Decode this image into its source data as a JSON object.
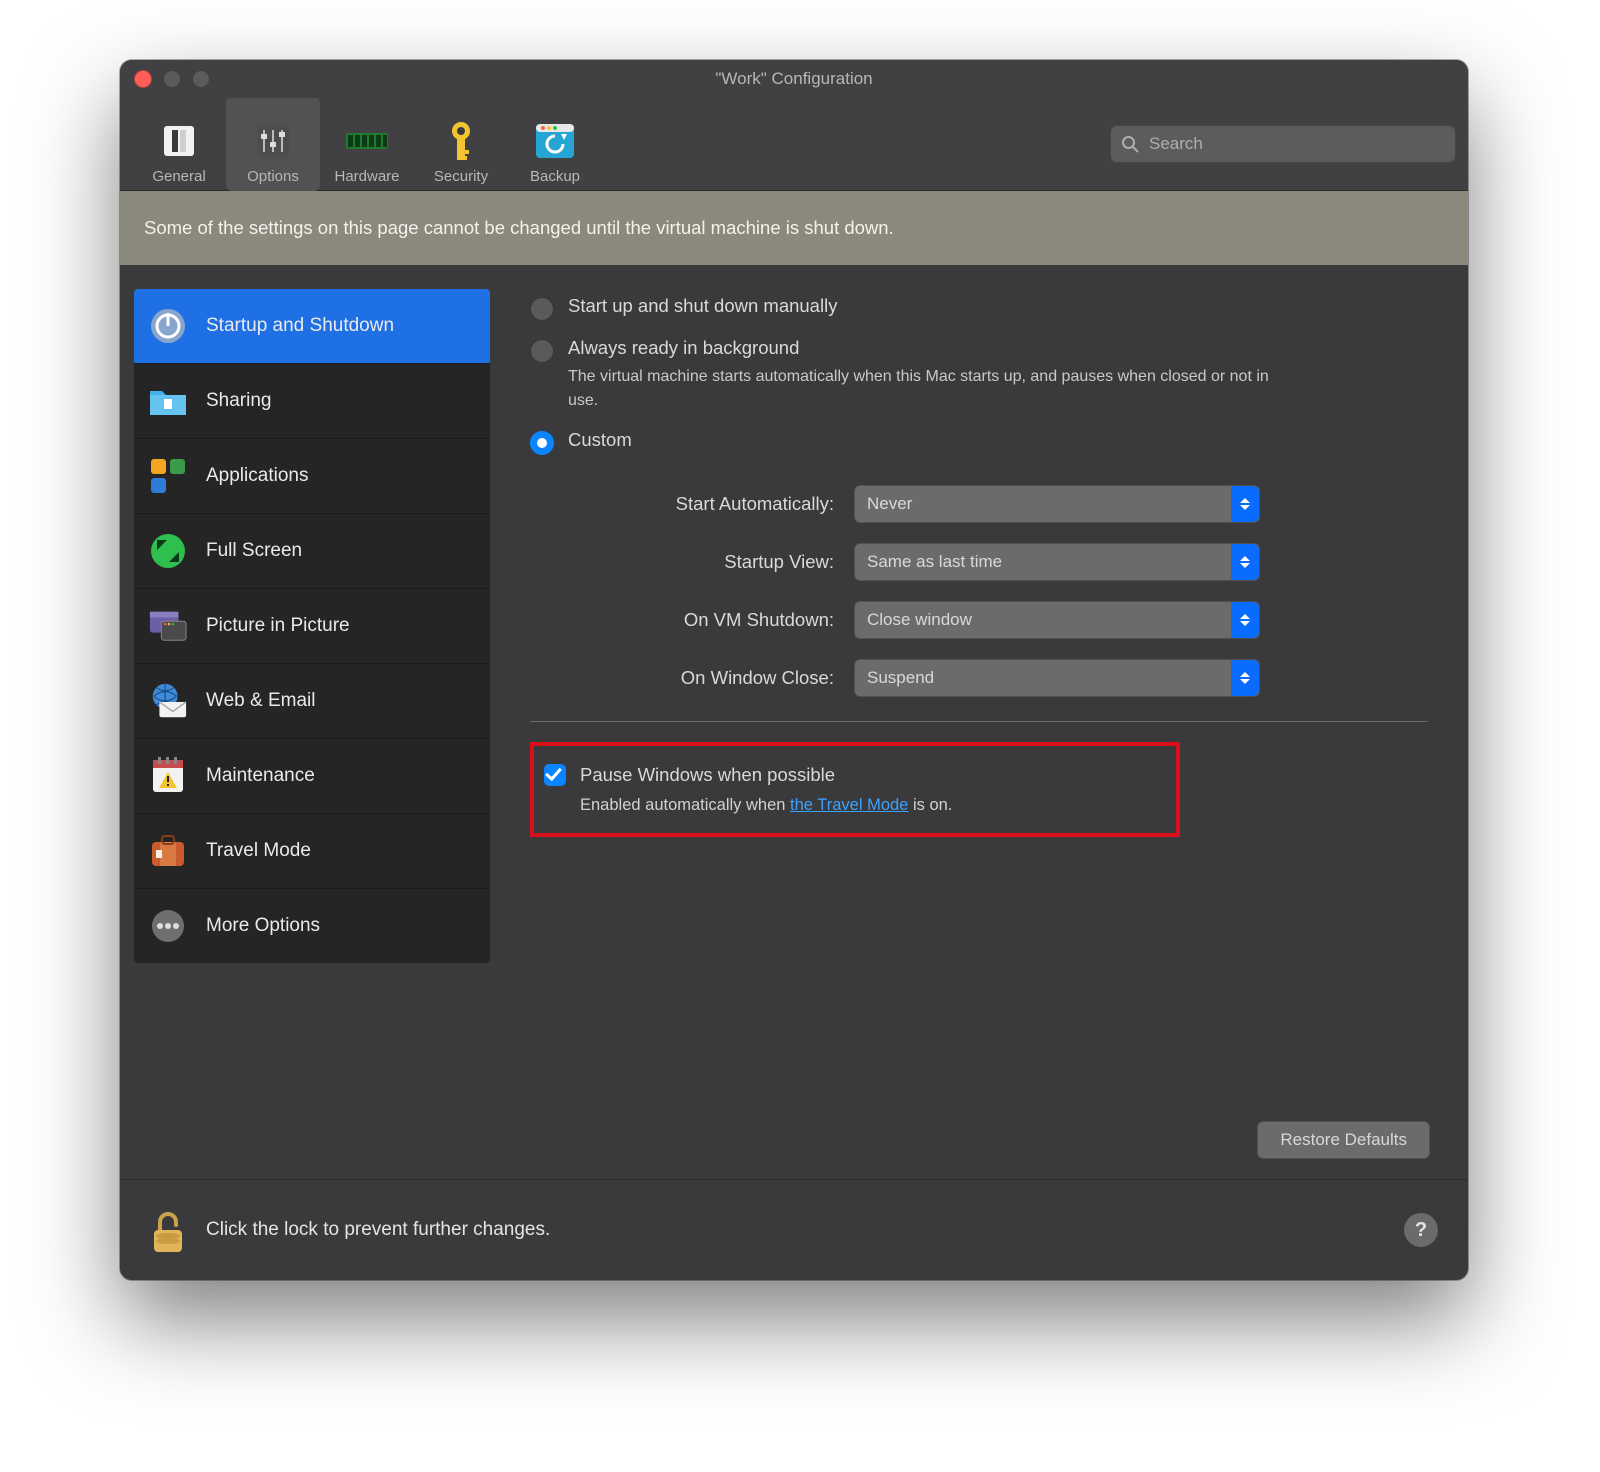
{
  "window": {
    "title": "\"Work\" Configuration"
  },
  "toolbar": {
    "items": [
      {
        "label": "General"
      },
      {
        "label": "Options"
      },
      {
        "label": "Hardware"
      },
      {
        "label": "Security"
      },
      {
        "label": "Backup"
      }
    ],
    "active_index": 1,
    "search_placeholder": "Search"
  },
  "banner": {
    "text": "Some of the settings on this page cannot be changed until the virtual machine is shut down."
  },
  "sidebar": {
    "items": [
      {
        "label": "Startup and Shutdown"
      },
      {
        "label": "Sharing"
      },
      {
        "label": "Applications"
      },
      {
        "label": "Full Screen"
      },
      {
        "label": "Picture in Picture"
      },
      {
        "label": "Web & Email"
      },
      {
        "label": "Maintenance"
      },
      {
        "label": "Travel Mode"
      },
      {
        "label": "More Options"
      }
    ],
    "selected_index": 0
  },
  "content": {
    "radios": {
      "manual": "Start up and shut down manually",
      "always_ready": "Always ready in background",
      "always_ready_desc": "The virtual machine starts automatically when this Mac starts up, and pauses when closed or not in use.",
      "custom": "Custom",
      "selected": "custom"
    },
    "fields": {
      "start_auto": {
        "label": "Start Automatically:",
        "value": "Never"
      },
      "startup_view": {
        "label": "Startup View:",
        "value": "Same as last time"
      },
      "on_shutdown": {
        "label": "On VM Shutdown:",
        "value": "Close window"
      },
      "on_close": {
        "label": "On Window Close:",
        "value": "Suspend"
      }
    },
    "pause": {
      "label": "Pause Windows when possible",
      "checked": true,
      "desc_prefix": "Enabled automatically when ",
      "desc_link": "the Travel Mode",
      "desc_suffix": " is on."
    },
    "restore_defaults": "Restore Defaults"
  },
  "footer": {
    "text": "Click the lock to prevent further changes.",
    "help": "?"
  }
}
